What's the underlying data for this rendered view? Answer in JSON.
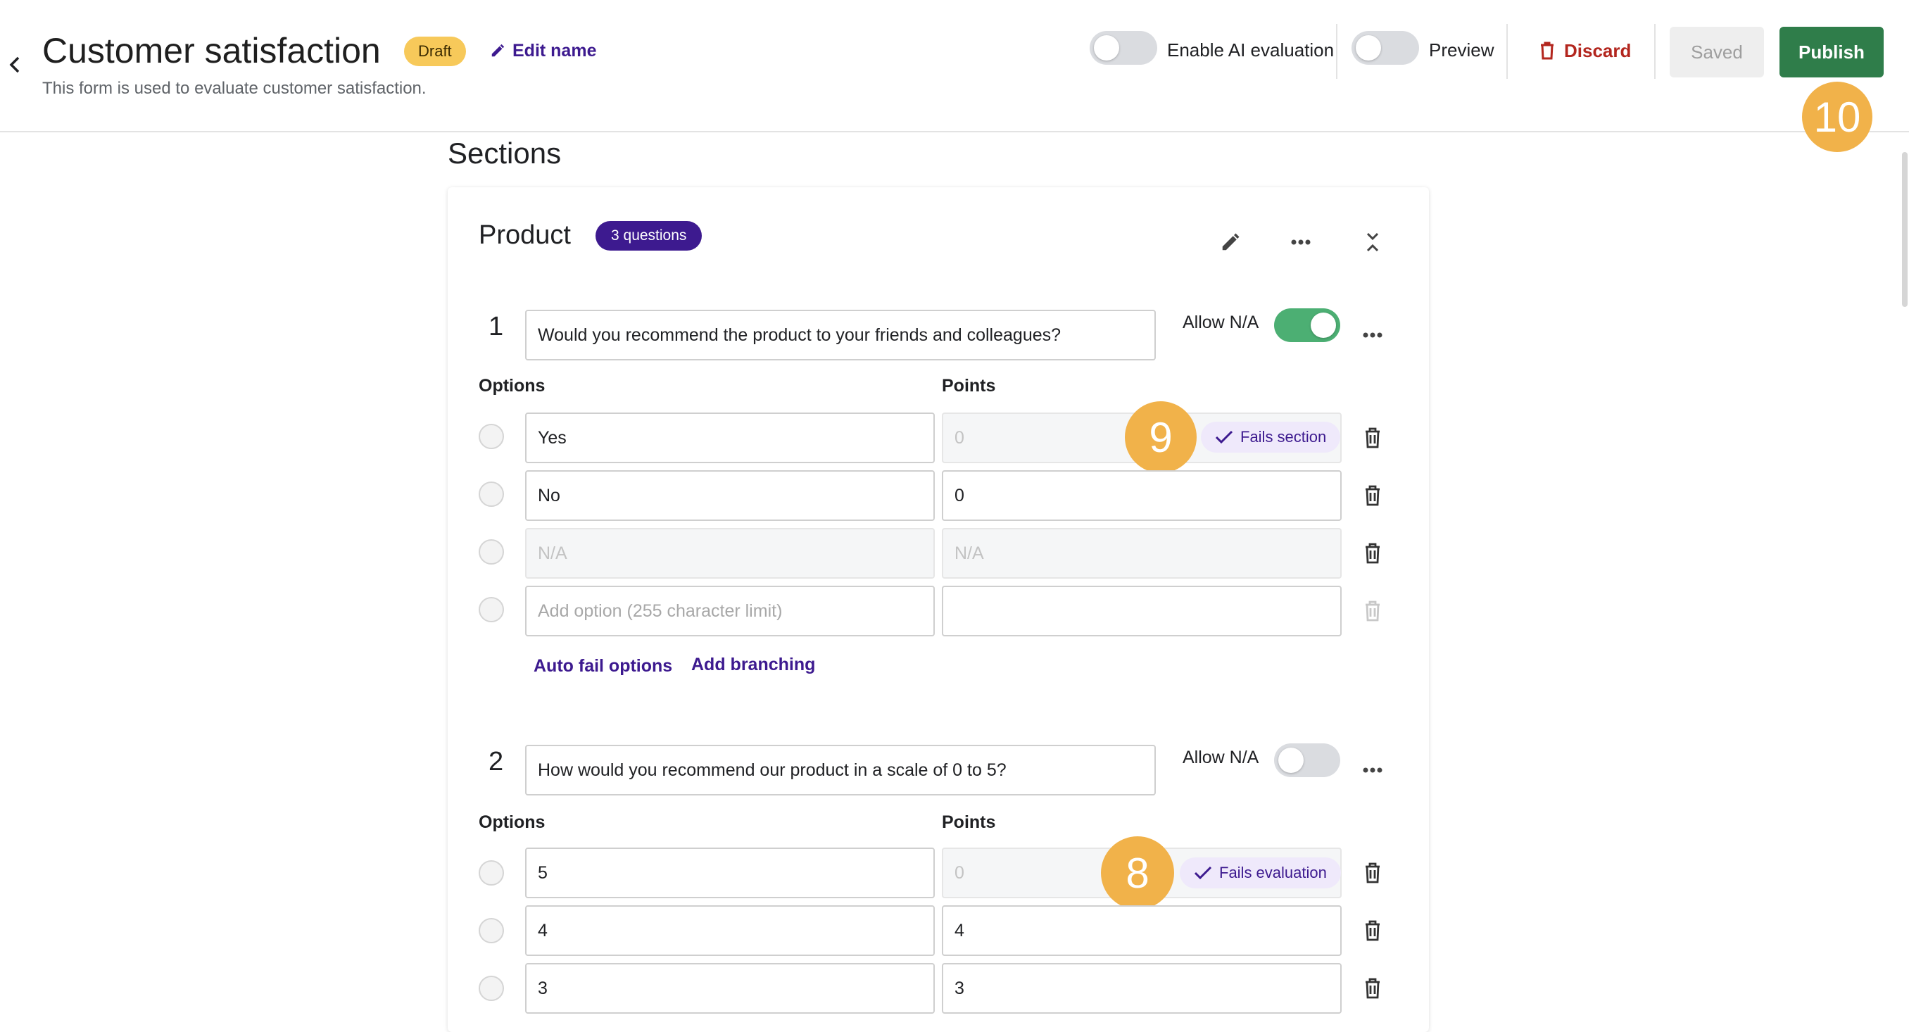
{
  "header": {
    "title": "Customer satisfaction",
    "status_badge": "Draft",
    "edit_name_label": "Edit name",
    "subtitle": "This form is used to evaluate customer satisfaction.",
    "ai_toggle_label": "Enable AI evaluation",
    "ai_toggle_on": false,
    "preview_label": "Preview",
    "preview_on": false,
    "discard_label": "Discard",
    "saved_label": "Saved",
    "publish_label": "Publish"
  },
  "callouts": [
    "10",
    "9",
    "8"
  ],
  "colors": {
    "accent": "#3d1a8f",
    "publish": "#2f7d4a",
    "discard": "#b3261e",
    "draft": "#f7c95a",
    "callout": "#f1b24a",
    "toggle_on": "#4caf73"
  },
  "sections_title": "Sections",
  "section": {
    "name": "Product",
    "question_count": "3 questions",
    "icons": [
      "pencil-icon",
      "more-horizontal-icon",
      "collapse-icon"
    ]
  },
  "questions": [
    {
      "number": "1",
      "text": "Would you recommend the product to your friends and colleagues?",
      "allow_na_label": "Allow N/A",
      "allow_na_on": true,
      "options_header": "Options",
      "points_header": "Points",
      "options": [
        {
          "label": "Yes",
          "points": "0",
          "points_disabled": true,
          "chip": "Fails section"
        },
        {
          "label": "No",
          "points": "0"
        },
        {
          "label": "N/A",
          "points": "N/A",
          "disabled": true
        },
        {
          "placeholder": "Add option (255 character limit)",
          "points": ""
        }
      ],
      "links": [
        "Auto fail options",
        "Add branching"
      ]
    },
    {
      "number": "2",
      "text": "How would you recommend our product in a scale of 0 to 5?",
      "allow_na_label": "Allow N/A",
      "allow_na_on": false,
      "options_header": "Options",
      "points_header": "Points",
      "options": [
        {
          "label": "5",
          "points": "0",
          "points_disabled": true,
          "chip": "Fails evaluation"
        },
        {
          "label": "4",
          "points": "4"
        },
        {
          "label": "3",
          "points": "3"
        }
      ]
    }
  ]
}
